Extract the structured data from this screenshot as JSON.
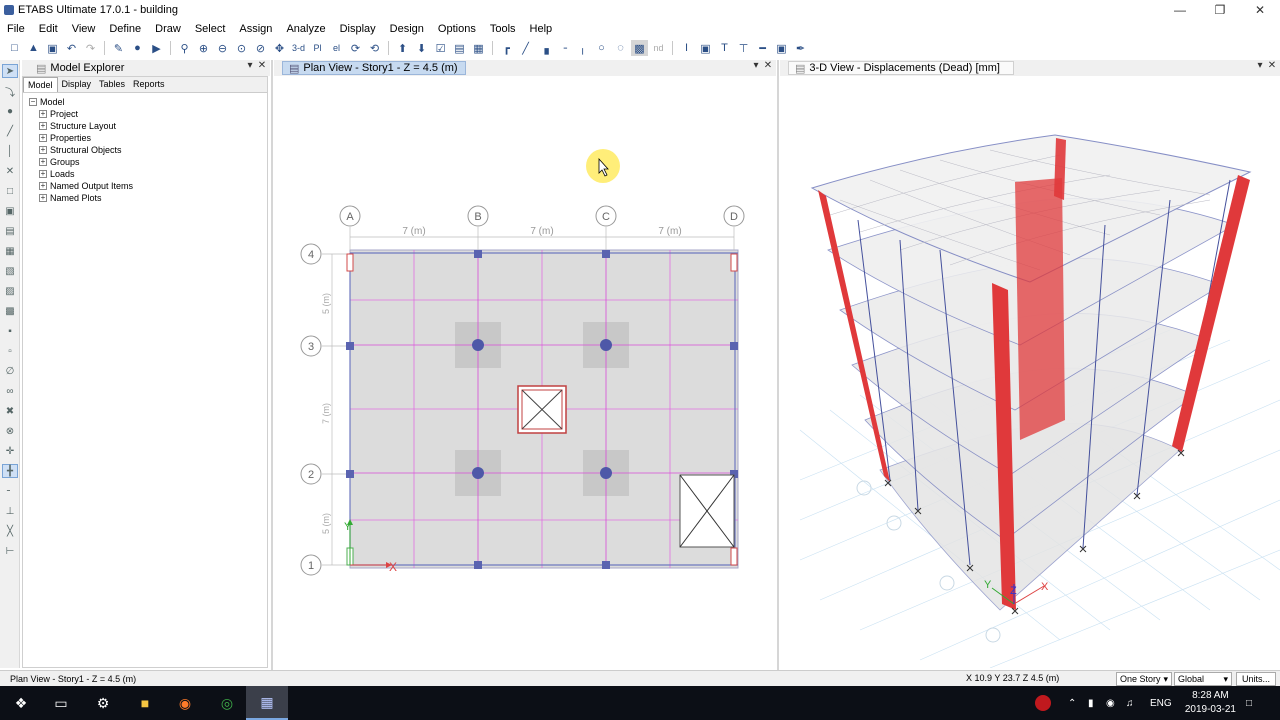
{
  "window": {
    "title": "ETABS Ultimate 17.0.1 - building"
  },
  "menu": [
    "File",
    "Edit",
    "View",
    "Define",
    "Draw",
    "Select",
    "Assign",
    "Analyze",
    "Display",
    "Design",
    "Options",
    "Tools",
    "Help"
  ],
  "toolbar": {
    "icons": [
      "new-icon",
      "open-icon",
      "save-icon",
      "undo-icon",
      "redo-icon",
      "pencil-icon",
      "lock-icon",
      "run-icon",
      "zoom-window-icon",
      "zoom-in-icon",
      "zoom-out-icon",
      "zoom-fit-icon",
      "zoom-prev-icon",
      "pan-icon",
      "3d-view-icon",
      "plan-view-icon",
      "elevation-view-icon",
      "rotate-icon",
      "refresh-icon",
      "story-up-icon",
      "story-down-icon",
      "object-check-icon",
      "display-options-icon",
      "perspective-icon",
      "draw-frame-icon",
      "draw-brace-icon",
      "draw-wall-icon",
      "draw-beam-icon",
      "draw-column-icon",
      "joint-icon",
      "link-icon",
      "shell-icon",
      "nd-icon",
      "dimension-icon",
      "section-icon",
      "beam-section-icon",
      "wall-section-icon",
      "line-style-icon",
      "fill-icon",
      "pen-icon"
    ],
    "text_labels": {
      "three_d": "3-d",
      "plan": "Pl",
      "elev": "el",
      "nd": "nd"
    }
  },
  "explorer": {
    "title": "Model Explorer",
    "tabs": [
      "Model",
      "Display",
      "Tables",
      "Reports"
    ],
    "root": "Model",
    "items": [
      "Project",
      "Structure Layout",
      "Properties",
      "Structural Objects",
      "Groups",
      "Loads",
      "Named Output Items",
      "Named Plots"
    ]
  },
  "planview": {
    "title": "Plan View - Story1 - Z = 4.5 (m)",
    "grid_x": [
      "A",
      "B",
      "C",
      "D"
    ],
    "grid_y": [
      "4",
      "3",
      "2",
      "1"
    ],
    "dim_x": [
      "7 (m)",
      "7 (m)",
      "7 (m)"
    ],
    "dim_y": [
      "5 (m)",
      "7 (m)",
      "5 (m)"
    ],
    "axis_x": "X",
    "axis_y": "Y"
  },
  "view3d": {
    "title": "3-D View  - Displacements (Dead)  [mm]",
    "axis_x": "X",
    "axis_y": "Y",
    "axis_z": "Z"
  },
  "statusbar": {
    "left": "Plan View - Story1 - Z = 4.5 (m)",
    "coords": "X 10.9  Y 23.7  Z 4.5 (m)",
    "story_select": "One Story",
    "coord_select": "Global",
    "units_button": "Units..."
  },
  "taskbar": {
    "lang": "ENG",
    "time": "8:28 AM",
    "date": "2019-03-21"
  },
  "colors": {
    "accent_tab": "#c7daf0",
    "grid_magenta": "#d84cd8",
    "column_red": "#e0393b",
    "frame_blue": "#3e4f9a"
  }
}
